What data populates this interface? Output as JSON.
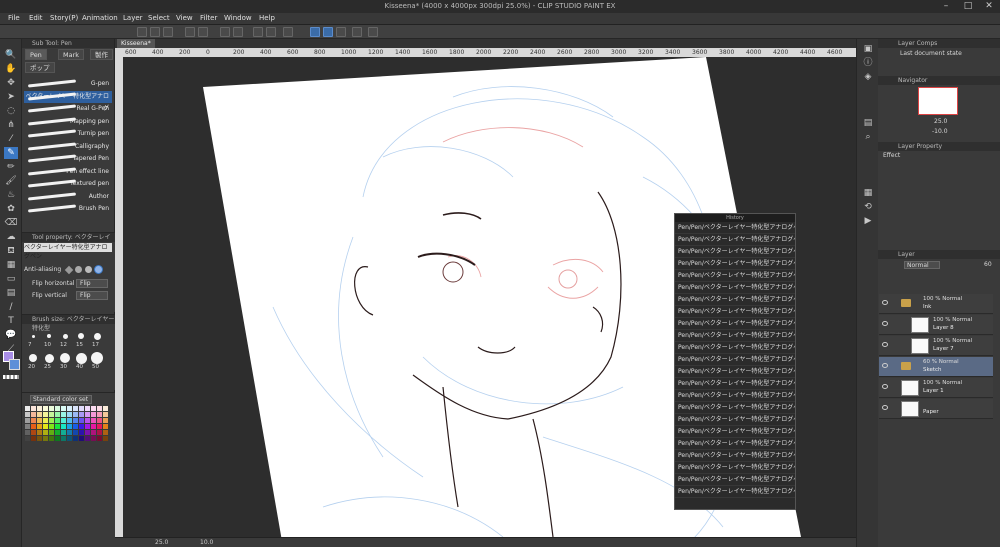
{
  "window": {
    "title": "Kisseena* (4000 x 4000px 300dpi 25.0%) - CLIP STUDIO PAINT EX"
  },
  "menu": [
    "File",
    "Edit",
    "Story(P)",
    "Animation",
    "Layer",
    "Select",
    "View",
    "Filter",
    "Window",
    "Help"
  ],
  "subtool": {
    "panel_title": "Sub Tool: Pen",
    "tabs": [
      "Pen",
      "Mark",
      "製作"
    ],
    "group_tab": "ポップ",
    "brushes": [
      "G-pen",
      "ベクターレイヤー特化型アナログ",
      "Real G-Pen",
      "Mapping pen",
      "Turnip pen",
      "Calligraphy",
      "Tapered Pen",
      "Pen effect line",
      "Textured pen",
      "Author",
      "Brush Pen"
    ],
    "selected_index": 1
  },
  "tool_property": {
    "title": "Tool property: ベクターレイヤー",
    "brush_name": "ベクターレイヤー特化型アナログペン",
    "anti_aliasing_label": "Anti-aliasing",
    "flip_horizontal_label": "Flip horizontal",
    "flip_horizontal_value": "Flip",
    "flip_vertical_label": "Flip vertical",
    "flip_vertical_value": "Flip"
  },
  "brush_size": {
    "title": "Brush size: ベクターレイヤー特化型",
    "sizes": [
      "7",
      "10",
      "12",
      "15",
      "17",
      "20",
      "25",
      "30",
      "40",
      "50"
    ]
  },
  "color_set": {
    "label": "Standard color set"
  },
  "canvas": {
    "doc_tab": "Kisseena*",
    "ruler_ticks": [
      "600",
      "400",
      "200",
      "0",
      "200",
      "400",
      "600",
      "800",
      "1000",
      "1200",
      "1400",
      "1600",
      "1800",
      "2000",
      "2200",
      "2400",
      "2600",
      "2800",
      "3000",
      "3200",
      "3400",
      "3600",
      "3800",
      "4000",
      "4200",
      "4400",
      "4600"
    ],
    "zoom": "25.0",
    "angle": "10.0"
  },
  "history": {
    "title": "History",
    "entry": "Pen/Pen/ベクターレイヤー特化型アナログペン",
    "count": 23
  },
  "layer_comps": {
    "title": "Layer Comps",
    "item": "Last document state"
  },
  "navigator": {
    "title": "Navigator",
    "zoom": "25.0",
    "angle": "-10.0"
  },
  "layer_property": {
    "title": "Layer Property",
    "effect_label": "Effect"
  },
  "layers": {
    "title": "Layer",
    "blend_mode": "Normal",
    "opacity": "60",
    "items": [
      {
        "line1": "100 % Normal",
        "line2": "Ink",
        "folder": true,
        "selected": false,
        "indent": 0
      },
      {
        "line1": "100 % Normal",
        "line2": "Layer 8",
        "folder": false,
        "selected": false,
        "indent": 1
      },
      {
        "line1": "100 % Normal",
        "line2": "Layer 7",
        "folder": false,
        "selected": false,
        "indent": 1
      },
      {
        "line1": "60 % Normal",
        "line2": "Sketch",
        "folder": true,
        "selected": true,
        "indent": 0
      },
      {
        "line1": "100 % Normal",
        "line2": "Layer 1",
        "folder": false,
        "selected": false,
        "indent": 0
      },
      {
        "line1": "",
        "line2": "Paper",
        "folder": false,
        "selected": false,
        "indent": 0
      }
    ]
  },
  "colors": {
    "main": "#a98ee8",
    "sub": "#5d8fd8",
    "accent": "#3b78c4"
  }
}
